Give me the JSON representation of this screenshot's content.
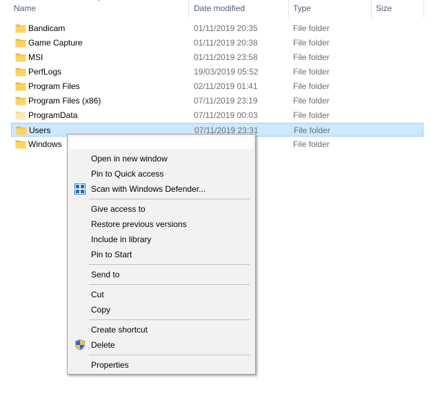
{
  "columns": {
    "name": "Name",
    "date_modified": "Date modified",
    "type": "Type",
    "size": "Size"
  },
  "files": [
    {
      "name": "Bandicam",
      "date": "01/11/2019 20:35",
      "type": "File folder",
      "icon": "folder-icon"
    },
    {
      "name": "Game Capture",
      "date": "01/11/2019 20:38",
      "type": "File folder",
      "icon": "folder-icon"
    },
    {
      "name": "MSI",
      "date": "01/11/2019 23:58",
      "type": "File folder",
      "icon": "folder-icon"
    },
    {
      "name": "PerfLogs",
      "date": "19/03/2019 05:52",
      "type": "File folder",
      "icon": "folder-icon"
    },
    {
      "name": "Program Files",
      "date": "02/11/2019 01:41",
      "type": "File folder",
      "icon": "folder-icon"
    },
    {
      "name": "Program Files (x86)",
      "date": "07/11/2019 23:19",
      "type": "File folder",
      "icon": "folder-icon"
    },
    {
      "name": "ProgramData",
      "date": "07/11/2019 00:03",
      "type": "File folder",
      "icon": "hidden-folder-icon"
    },
    {
      "name": "Users",
      "date": "07/11/2019 23:31",
      "type": "File folder",
      "icon": "folder-icon",
      "selected": true
    },
    {
      "name": "Windows",
      "date": "",
      "type": "File folder",
      "icon": "folder-icon"
    }
  ],
  "context_menu": {
    "groups": [
      [
        {
          "label": "Open in new window"
        },
        {
          "label": "Pin to Quick access"
        },
        {
          "label": "Scan with Windows Defender...",
          "icon": "windows-defender-icon"
        }
      ],
      [
        {
          "label": "Give access to"
        },
        {
          "label": "Restore previous versions"
        },
        {
          "label": "Include in library"
        },
        {
          "label": "Pin to Start"
        }
      ],
      [
        {
          "label": "Send to"
        }
      ],
      [
        {
          "label": "Cut"
        },
        {
          "label": "Copy"
        }
      ],
      [
        {
          "label": "Create shortcut"
        },
        {
          "label": "Delete",
          "icon": "uac-shield-icon"
        }
      ],
      [
        {
          "label": "Properties"
        }
      ]
    ]
  },
  "colors": {
    "selection_bg": "#cce8ff",
    "selection_border": "#99d1ff",
    "header_text": "#4c607a",
    "folder_yellow": "#ffd35c",
    "menu_bg": "#f2f2f2"
  }
}
